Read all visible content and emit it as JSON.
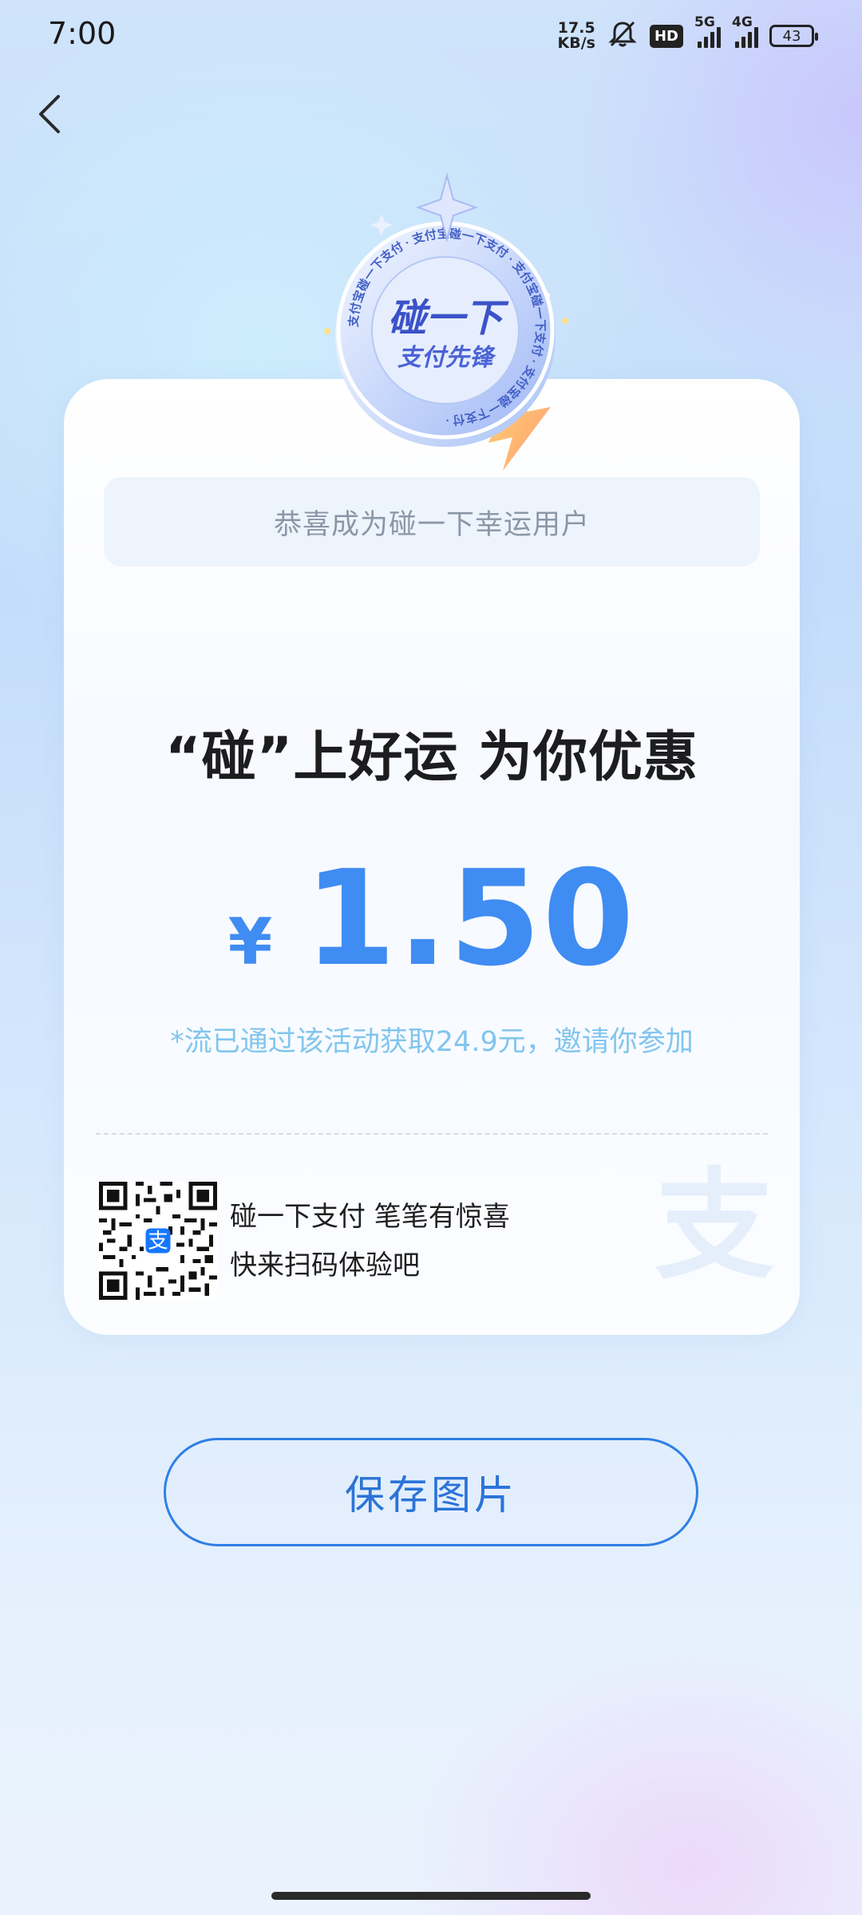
{
  "status_bar": {
    "time": "7:00",
    "net_speed_value": "17.5",
    "net_speed_unit": "KB/s",
    "hd_label": "HD",
    "signal1_label": "5G",
    "signal2_label": "4G",
    "battery": "43"
  },
  "icons": {
    "back": "chevron-left-icon",
    "mute": "bell-off-icon",
    "medal": "medal-badge-icon",
    "watermark": "alipay-logo-icon"
  },
  "medal": {
    "title_line1": "碰一下",
    "title_line2": "支付先锋",
    "ring_text": "支付宝碰一下支付 · 支付宝碰一下支付 · 支付宝碰一下支付 · 支付宝碰一下支付 ·"
  },
  "card": {
    "lucky_banner": "恭喜成为碰一下幸运用户",
    "headline": "“碰”上好运 为你优惠",
    "currency": "¥",
    "amount": "1.50",
    "note": "*流已通过该活动获取24.9元，邀请你参加",
    "promo_line1": "碰一下支付 笔笔有惊喜",
    "promo_line2": "快来扫码体验吧",
    "watermark_char": "支",
    "qr_center_char": "支"
  },
  "actions": {
    "save_label": "保存图片"
  },
  "colors": {
    "accent_blue": "#3f8cf2",
    "note_blue": "#82c5ee",
    "button_border": "#2f7fe6"
  }
}
